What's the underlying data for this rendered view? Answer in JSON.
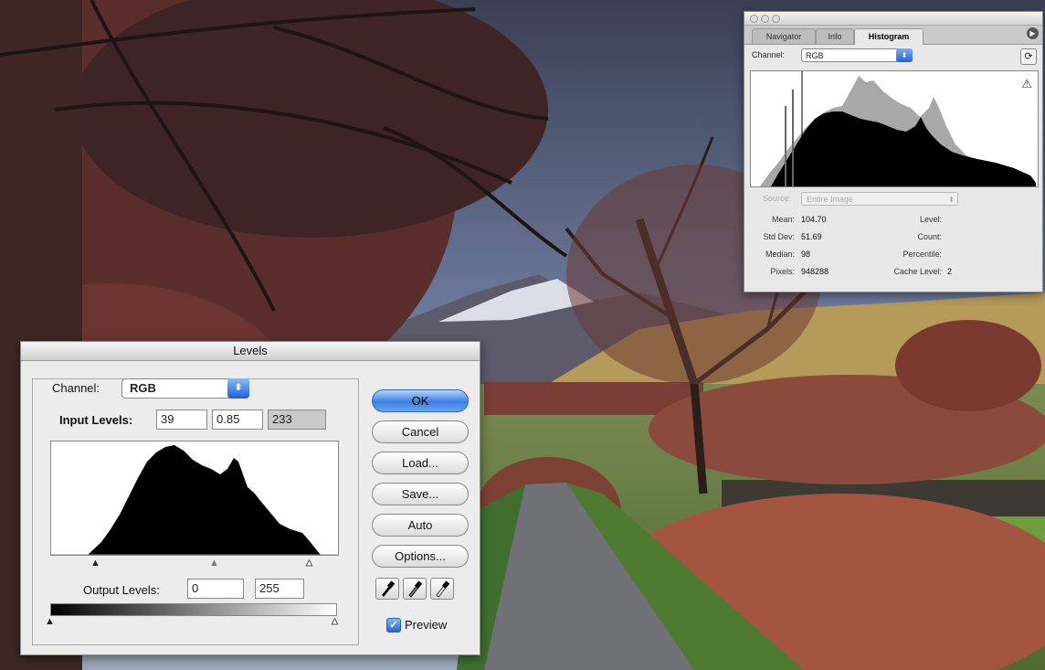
{
  "histogram_palette": {
    "tabs": [
      "Navigator",
      "Info",
      "Histogram"
    ],
    "active_tab": "Histogram",
    "channel_label": "Channel:",
    "channel_value": "RGB",
    "source_label": "Source:",
    "source_value": "Entire Image",
    "stats": {
      "mean_label": "Mean:",
      "mean": "104.70",
      "stddev_label": "Std Dev:",
      "stddev": "51.69",
      "median_label": "Median:",
      "median": "98",
      "pixels_label": "Pixels:",
      "pixels": "948288",
      "level_label": "Level:",
      "count_label": "Count:",
      "percentile_label": "Percentile:",
      "cache_label": "Cache Level:",
      "cache": "2"
    }
  },
  "levels_dialog": {
    "title": "Levels",
    "channel_label": "Channel:",
    "channel_value": "RGB",
    "input_label": "Input Levels:",
    "input_black": "39",
    "input_gamma": "0.85",
    "input_white": "233",
    "output_label": "Output Levels:",
    "output_black": "0",
    "output_white": "255",
    "buttons": {
      "ok": "OK",
      "cancel": "Cancel",
      "load": "Load...",
      "save": "Save...",
      "auto": "Auto",
      "options": "Options..."
    },
    "preview_label": "Preview",
    "preview_checked": true
  },
  "colors": {
    "accent": "#2466d6",
    "histogram_fill": "#000000",
    "histogram_overlay": "#a8a8a8"
  }
}
